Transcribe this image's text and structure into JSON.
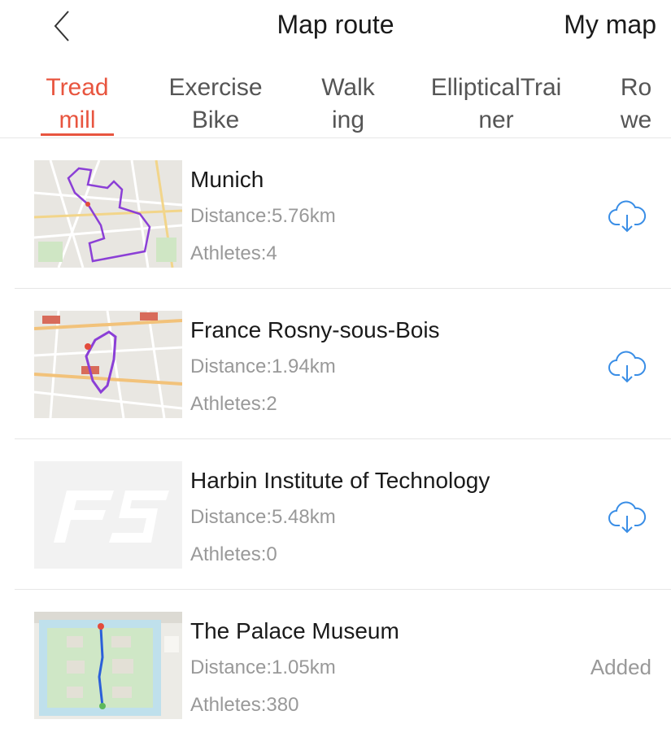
{
  "header": {
    "title": "Map route",
    "my_map": "My map"
  },
  "tabs": [
    {
      "lines": [
        "Tread",
        "mill"
      ],
      "active": true
    },
    {
      "lines": [
        "Exercise",
        "Bike"
      ],
      "active": false
    },
    {
      "lines": [
        "Walk",
        "ing"
      ],
      "active": false
    },
    {
      "lines": [
        "EllipticalTrai",
        "ner"
      ],
      "active": false
    },
    {
      "lines": [
        "Ro",
        "we"
      ],
      "active": false
    }
  ],
  "routes": [
    {
      "name": "Munich",
      "distance": "Distance:5.76km",
      "athletes": "Athletes:4",
      "action": "download-icon"
    },
    {
      "name": "France Rosny-sous-Bois",
      "distance": "Distance:1.94km",
      "athletes": "Athletes:2",
      "action": "download-icon"
    },
    {
      "name": "Harbin Institute of Technology",
      "distance": "Distance:5.48km",
      "athletes": "Athletes:0",
      "action": "download-icon"
    },
    {
      "name": "The Palace Museum",
      "distance": "Distance:1.05km",
      "athletes": "Athletes:380",
      "action": "Added"
    }
  ],
  "colors": {
    "accent": "#e8553f",
    "download_icon": "#3a8ee6",
    "route_purple": "#8b3fd6",
    "route_blue": "#2b5fd9",
    "secondary_text": "#999999"
  }
}
